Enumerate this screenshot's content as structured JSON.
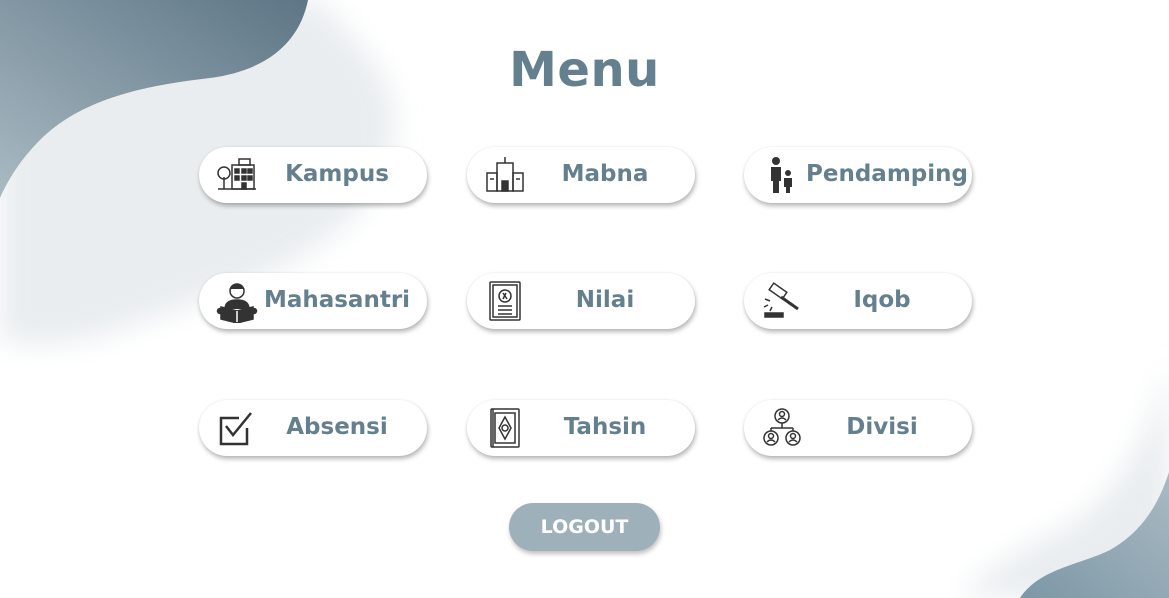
{
  "page": {
    "title": "Menu"
  },
  "menu": [
    {
      "label": "Kampus",
      "icon": "campus-building-icon"
    },
    {
      "label": "Mabna",
      "icon": "dormitory-building-icon"
    },
    {
      "label": "Pendamping",
      "icon": "guardian-with-child-icon"
    },
    {
      "label": "Mahasantri",
      "icon": "student-reading-icon"
    },
    {
      "label": "Nilai",
      "icon": "grade-certificate-icon"
    },
    {
      "label": "Iqob",
      "icon": "gavel-icon"
    },
    {
      "label": "Absensi",
      "icon": "checkbox-icon"
    },
    {
      "label": "Tahsin",
      "icon": "quran-book-icon"
    },
    {
      "label": "Divisi",
      "icon": "organization-people-icon"
    }
  ],
  "logout": {
    "label": "LOGOUT"
  },
  "colors": {
    "accent": "#64808f",
    "logout_button": "#9eb0ba",
    "background": "#ffffff",
    "blob_light": "#a3b6c0",
    "blob_dark": "#5b7484",
    "icon": "#333333"
  }
}
